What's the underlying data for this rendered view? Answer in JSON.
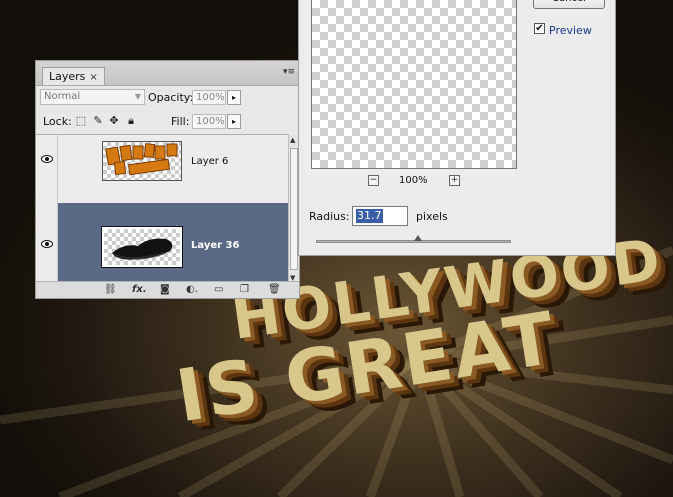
{
  "layers_panel": {
    "tab_label": "Layers",
    "tab_close": "×",
    "menu_icon": "panel-menu-icon",
    "blend_mode": "Normal",
    "opacity_label": "Opacity:",
    "opacity_value": "100%",
    "lock_label": "Lock:",
    "fill_label": "Fill:",
    "fill_value": "100%",
    "layers": [
      {
        "name": "Layer 6",
        "selected": false,
        "visible": true
      },
      {
        "name": "Layer 36",
        "selected": true,
        "visible": true
      }
    ],
    "footer_icons": [
      "link-icon",
      "fx-icon",
      "mask-icon",
      "adjustment-icon",
      "folder-icon",
      "new-layer-icon",
      "trash-icon"
    ],
    "fx_label": "fx"
  },
  "blur_dialog": {
    "cancel_label": "Cancel",
    "preview_checked": true,
    "preview_label": "Preview",
    "zoom_out": "−",
    "zoom_in": "+",
    "zoom_level": "100%",
    "radius_label": "Radius:",
    "radius_value": "31.7",
    "radius_unit": "pixels"
  },
  "canvas": {
    "text_line1": "HOLLYWOOD",
    "text_line2": "IS GREAT"
  },
  "colors": {
    "selected_row": "#5a6a86",
    "selection_highlight": "#3a5fa8"
  }
}
